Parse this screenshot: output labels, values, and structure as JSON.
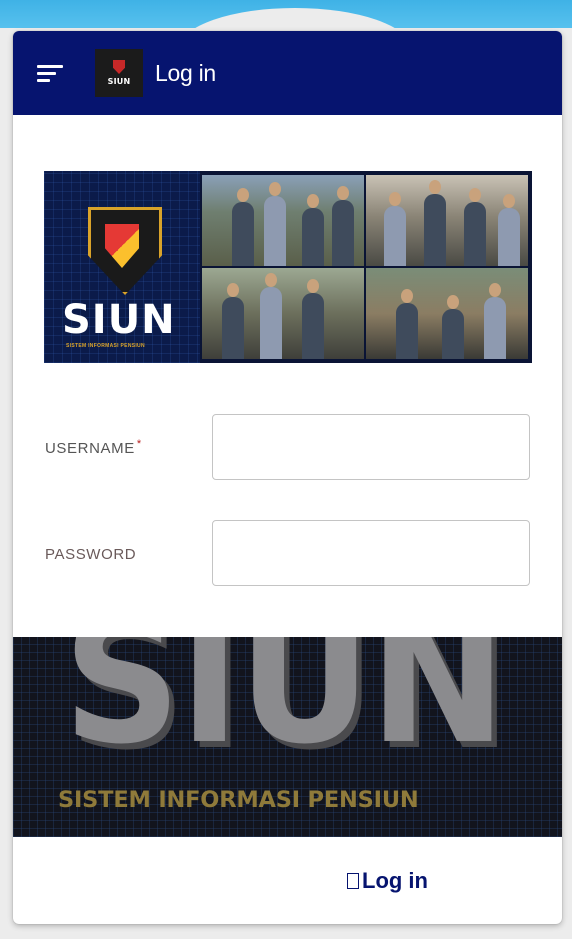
{
  "header": {
    "title": "Log in",
    "logo_text": "SIUN",
    "menu_icon": "menu-icon"
  },
  "banner": {
    "logo_text": "SIUN",
    "logo_subtitle": "SISTEM INFORMASI PENSIUN"
  },
  "form": {
    "username_label": "USERNAME",
    "username_required": "*",
    "username_value": "",
    "password_label": "PASSWORD",
    "password_value": ""
  },
  "footer_banner": {
    "logo_text": "SIUN",
    "tagline": "SISTEM INFORMASI PENSIUN"
  },
  "actions": {
    "login_label": "Log in",
    "login_icon": "login-icon"
  },
  "colors": {
    "header_bg": "#06146f",
    "accent": "#06146f",
    "required": "#b71c1c"
  }
}
